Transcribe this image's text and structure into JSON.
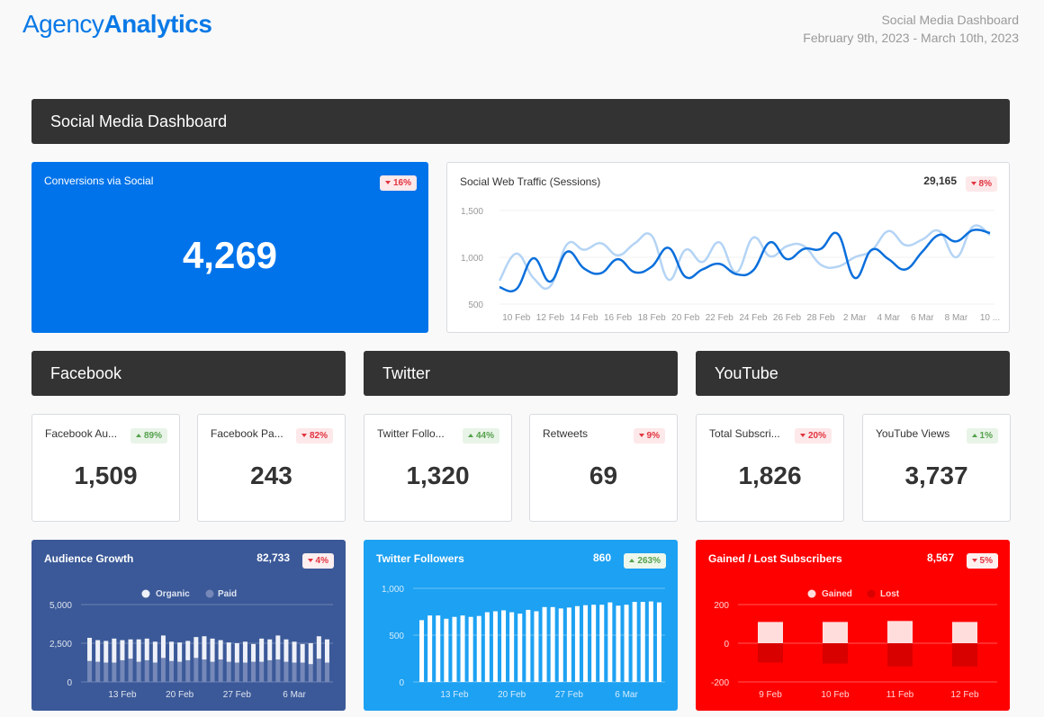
{
  "header": {
    "logo_light": "Agency",
    "logo_bold": "Analytics",
    "report_title": "Social Media Dashboard",
    "date_range": "February 9th, 2023 - March 10th, 2023"
  },
  "main_section": {
    "title": "Social Media Dashboard"
  },
  "conversions": {
    "title": "Conversions via Social",
    "value": "4,269",
    "change": "16%",
    "direction": "down",
    "color": "#0073ea"
  },
  "web_traffic": {
    "title": "Social Web Traffic (Sessions)",
    "total": "29,165",
    "change": "8%",
    "direction": "down"
  },
  "sections": [
    {
      "title": "Facebook"
    },
    {
      "title": "Twitter"
    },
    {
      "title": "YouTube"
    }
  ],
  "kpis": [
    {
      "title": "Facebook Au...",
      "value": "1,509",
      "change": "89%",
      "direction": "up"
    },
    {
      "title": "Facebook Pa...",
      "value": "243",
      "change": "82%",
      "direction": "down"
    },
    {
      "title": "Twitter Follo...",
      "value": "1,320",
      "change": "44%",
      "direction": "up"
    },
    {
      "title": "Retweets",
      "value": "69",
      "change": "9%",
      "direction": "down"
    },
    {
      "title": "Total Subscri...",
      "value": "1,826",
      "change": "20%",
      "direction": "down"
    },
    {
      "title": "YouTube Views",
      "value": "3,737",
      "change": "1%",
      "direction": "up"
    }
  ],
  "audience_growth": {
    "title": "Audience Growth",
    "total": "82,733",
    "change": "4%",
    "direction": "down",
    "color": "#3b5998"
  },
  "twitter_followers": {
    "title": "Twitter Followers",
    "total": "860",
    "change": "263%",
    "direction": "up",
    "color": "#1da1f2"
  },
  "gained_lost": {
    "title": "Gained / Lost Subscribers",
    "total": "8,567",
    "change": "5%",
    "direction": "down",
    "color": "#ff0000"
  },
  "chart_data": [
    {
      "id": "web_traffic",
      "type": "line",
      "title": "Social Web Traffic (Sessions)",
      "x": [
        "9 Feb",
        "10 Feb",
        "11 Feb",
        "12 Feb",
        "13 Feb",
        "14 Feb",
        "15 Feb",
        "16 Feb",
        "17 Feb",
        "18 Feb",
        "19 Feb",
        "20 Feb",
        "21 Feb",
        "22 Feb",
        "23 Feb",
        "24 Feb",
        "25 Feb",
        "26 Feb",
        "27 Feb",
        "28 Feb",
        "1 Mar",
        "2 Mar",
        "3 Mar",
        "4 Mar",
        "5 Mar",
        "6 Mar",
        "7 Mar",
        "8 Mar",
        "9 Mar",
        "10 Mar"
      ],
      "xtick_labels": [
        "10 Feb",
        "12 Feb",
        "14 Feb",
        "16 Feb",
        "18 Feb",
        "20 Feb",
        "22 Feb",
        "24 Feb",
        "26 Feb",
        "28 Feb",
        "2 Mar",
        "4 Mar",
        "6 Mar",
        "8 Mar",
        "10 ..."
      ],
      "yticks": [
        "1,500",
        "1,000",
        "500"
      ],
      "ylim": [
        500,
        1500
      ],
      "series": [
        {
          "name": "Current",
          "color": "#0a6fdc",
          "values": [
            680,
            660,
            990,
            740,
            1060,
            880,
            830,
            980,
            840,
            900,
            1100,
            790,
            870,
            930,
            820,
            860,
            1160,
            980,
            1090,
            1090,
            1250,
            780,
            1080,
            980,
            870,
            1060,
            1240,
            1170,
            1290,
            1260
          ]
        },
        {
          "name": "Previous",
          "color": "#b4d4f5",
          "values": [
            750,
            1040,
            780,
            690,
            1140,
            1080,
            1150,
            1020,
            1150,
            1230,
            760,
            1080,
            950,
            1160,
            840,
            1210,
            1010,
            1120,
            1120,
            920,
            900,
            1000,
            1070,
            1280,
            1130,
            1190,
            1280,
            1000,
            1330,
            1240
          ]
        }
      ]
    },
    {
      "id": "audience_growth",
      "type": "bar",
      "stacked": true,
      "title": "Audience Growth",
      "legend": [
        "Organic",
        "Paid"
      ],
      "legend_position": "top",
      "xtick_labels": [
        "13 Feb",
        "20 Feb",
        "27 Feb",
        "6 Mar"
      ],
      "yticks": [
        "5,000",
        "2,500",
        "0"
      ],
      "ylim": [
        0,
        5000
      ],
      "series": [
        {
          "name": "Paid",
          "color": "#7588b8",
          "values": [
            1350,
            1300,
            1250,
            1250,
            1400,
            1500,
            1300,
            1400,
            1250,
            1550,
            1350,
            1300,
            1400,
            1550,
            1450,
            1300,
            1450,
            1300,
            1250,
            1250,
            1300,
            1300,
            1400,
            1450,
            1300,
            1250,
            1250,
            1150,
            1500,
            1250
          ]
        },
        {
          "name": "Organic",
          "color": "#eef1f8",
          "values": [
            1500,
            1400,
            1400,
            1550,
            1300,
            1250,
            1450,
            1400,
            1350,
            1450,
            1250,
            1250,
            1250,
            1350,
            1500,
            1500,
            1250,
            1250,
            1250,
            1350,
            1150,
            1500,
            1350,
            1550,
            1450,
            1350,
            1200,
            1350,
            1450,
            1500
          ]
        }
      ]
    },
    {
      "id": "twitter_followers",
      "type": "bar",
      "title": "Twitter Followers",
      "xtick_labels": [
        "13 Feb",
        "20 Feb",
        "27 Feb",
        "6 Mar"
      ],
      "yticks": [
        "1,000",
        "500",
        "0"
      ],
      "ylim": [
        0,
        1000
      ],
      "series": [
        {
          "name": "Followers",
          "color": "#ffffff",
          "values": [
            660,
            710,
            710,
            675,
            695,
            710,
            695,
            705,
            745,
            755,
            765,
            745,
            730,
            770,
            755,
            800,
            800,
            785,
            795,
            810,
            820,
            825,
            825,
            850,
            815,
            825,
            855,
            855,
            860,
            850
          ]
        }
      ]
    },
    {
      "id": "gained_lost",
      "type": "bar",
      "title": "Gained / Lost Subscribers",
      "legend": [
        "Gained",
        "Lost"
      ],
      "legend_position": "top",
      "categories": [
        "9 Feb",
        "10 Feb",
        "11 Feb",
        "12 Feb"
      ],
      "yticks": [
        "200",
        "0",
        "-200"
      ],
      "ylim": [
        -200,
        200
      ],
      "series": [
        {
          "name": "Gained",
          "color": "#ffdddd",
          "values": [
            110,
            110,
            115,
            110
          ]
        },
        {
          "name": "Lost",
          "color": "#d90000",
          "values": [
            -100,
            -105,
            -120,
            -120
          ]
        }
      ]
    }
  ]
}
